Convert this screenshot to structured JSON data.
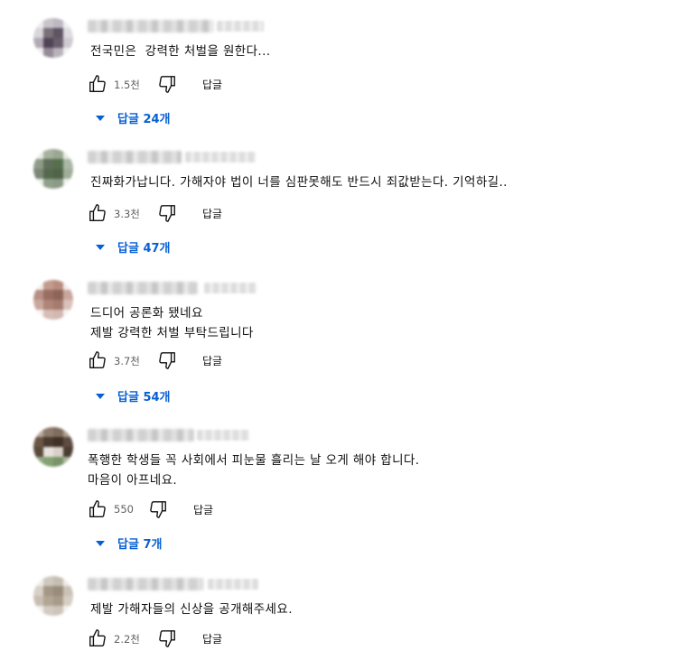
{
  "reply_label": "답글",
  "comments": [
    {
      "text": "전국민은  강력한 처벌을 원한다...",
      "likes": "1.5천",
      "replies_label": "답글 24개",
      "avatar_colors": [
        "#ecebed",
        "#c8c4ca",
        "#bdb8c2",
        "#eeedef",
        "#d9d6da",
        "#7a7079",
        "#5e5462",
        "#dedbe0",
        "#b2aab5",
        "#4f4455",
        "#6a5e6e",
        "#cfc9d1",
        "#efeef0",
        "#968c99",
        "#b9b2bc",
        "#f2f1f3"
      ]
    },
    {
      "text": "진짜화가납니다. 가해자야 법이 너를 심판못해도 반드시 죄값받는다. 기억하길..",
      "likes": "3.3천",
      "replies_label": "답글 47개",
      "avatar_colors": [
        "#e8ece6",
        "#a6b29e",
        "#9aa891",
        "#e6ebe3",
        "#8f9b88",
        "#5f6f59",
        "#56704d",
        "#a9b7a4",
        "#7c8776",
        "#55694f",
        "#4f6448",
        "#9fae98",
        "#ebefe9",
        "#90a08a",
        "#8c9a86",
        "#edf0eb"
      ]
    },
    {
      "text": "드디어 공론화 됐네요\n제발 강력한 처벌 부탁드립니다",
      "likes": "3.7천",
      "replies_label": "답글 54개",
      "avatar_colors": [
        "#f3eeec",
        "#c29b8e",
        "#b88d80",
        "#f2ece9",
        "#b78f84",
        "#9b6d63",
        "#8e6459",
        "#c9a69b",
        "#c8a89d",
        "#b08478",
        "#a67b6f",
        "#d9c2ba",
        "#f6f2f0",
        "#d6beb6",
        "#d2b8b0",
        "#f7f3f1"
      ]
    },
    {
      "text": "폭행한 학생들 꼭 사회에서 피눈물 흘리는 날 오게 해야 합니다.\n마음이 아프네요.",
      "likes": "550",
      "replies_label": "답글 7개",
      "avatar_colors": [
        "#b7a99d",
        "#8d7a6b",
        "#7f6d5e",
        "#ad9f93",
        "#6a5647",
        "#4a3a2f",
        "#3f3128",
        "#5e4c40",
        "#5a4a3c",
        "#e8e2dd",
        "#d9d0c9",
        "#4b3c31",
        "#94a887",
        "#85a073",
        "#7a9469",
        "#a9b89c"
      ]
    },
    {
      "text": "제발 가해자들의 신상을 공개해주세요.",
      "likes": "2.2천",
      "replies_label": "",
      "avatar_colors": [
        "#efedea",
        "#cfc8bf",
        "#c6beb4",
        "#eeebe8",
        "#d8d1c8",
        "#a49786",
        "#9a8c7a",
        "#cbc2b6",
        "#c8beb2",
        "#b2a594",
        "#a99b8a",
        "#d6cec3",
        "#f2f0ed",
        "#d3cbc1",
        "#cec5ba",
        "#f4f2f0"
      ]
    }
  ]
}
